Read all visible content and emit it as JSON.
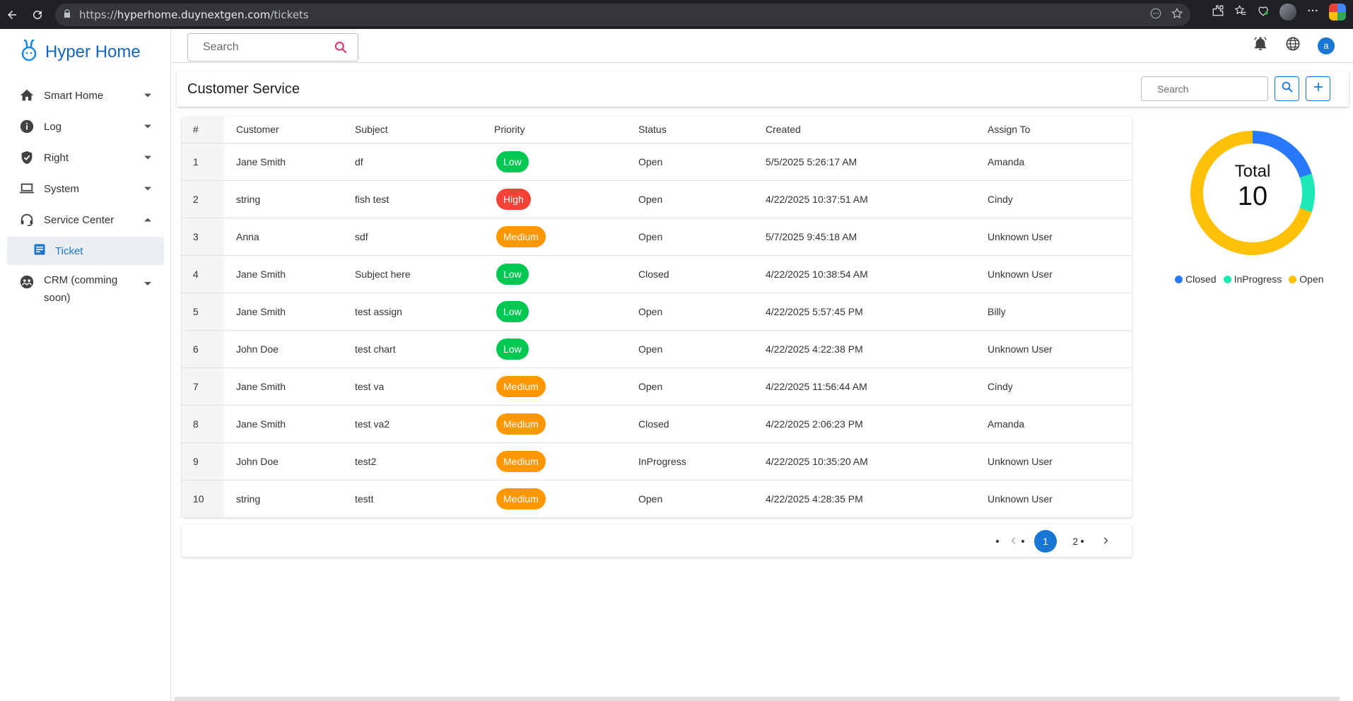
{
  "browser": {
    "url_scheme": "https://",
    "url_host": "hyperhome.duynextgen.com",
    "url_path": "/tickets"
  },
  "brand": {
    "name": "Hyper Home"
  },
  "sidebar": {
    "items": [
      {
        "label": "Smart Home",
        "icon": "home-icon",
        "expanded": false
      },
      {
        "label": "Log",
        "icon": "info-icon",
        "expanded": false
      },
      {
        "label": "Right",
        "icon": "shield-icon",
        "expanded": false
      },
      {
        "label": "System",
        "icon": "laptop-icon",
        "expanded": false
      },
      {
        "label": "Service Center",
        "icon": "headset-icon",
        "expanded": true,
        "children": [
          {
            "label": "Ticket",
            "icon": "ticket-icon",
            "active": true
          }
        ]
      },
      {
        "label": "CRM (comming soon)",
        "icon": "crm-icon",
        "expanded": false
      }
    ]
  },
  "topbar": {
    "search_placeholder": "Search",
    "user_initial": "a"
  },
  "header": {
    "title": "Customer Service",
    "search_placeholder": "Search"
  },
  "table": {
    "columns": [
      "#",
      "Customer",
      "Subject",
      "Priority",
      "Status",
      "Created",
      "Assign To"
    ],
    "rows": [
      {
        "num": "1",
        "customer": "Jane Smith",
        "subject": "df",
        "priority": "Low",
        "status": "Open",
        "created": "5/5/2025 5:26:17 AM",
        "assign": "Amanda"
      },
      {
        "num": "2",
        "customer": "string",
        "subject": "fish test",
        "priority": "High",
        "status": "Open",
        "created": "4/22/2025 10:37:51 AM",
        "assign": "Cindy"
      },
      {
        "num": "3",
        "customer": "Anna",
        "subject": "sdf",
        "priority": "Medium",
        "status": "Open",
        "created": "5/7/2025 9:45:18 AM",
        "assign": "Unknown User"
      },
      {
        "num": "4",
        "customer": "Jane Smith",
        "subject": "Subject here",
        "priority": "Low",
        "status": "Closed",
        "created": "4/22/2025 10:38:54 AM",
        "assign": "Unknown User"
      },
      {
        "num": "5",
        "customer": "Jane Smith",
        "subject": "test assign",
        "priority": "Low",
        "status": "Open",
        "created": "4/22/2025 5:57:45 PM",
        "assign": "Billy"
      },
      {
        "num": "6",
        "customer": "John Doe",
        "subject": "test chart",
        "priority": "Low",
        "status": "Open",
        "created": "4/22/2025 4:22:38 PM",
        "assign": "Unknown User"
      },
      {
        "num": "7",
        "customer": "Jane Smith",
        "subject": "test va",
        "priority": "Medium",
        "status": "Open",
        "created": "4/22/2025 11:56:44 AM",
        "assign": "Cindy"
      },
      {
        "num": "8",
        "customer": "Jane Smith",
        "subject": "test va2",
        "priority": "Medium",
        "status": "Closed",
        "created": "4/22/2025 2:06:23 PM",
        "assign": "Amanda"
      },
      {
        "num": "9",
        "customer": "John Doe",
        "subject": "test2",
        "priority": "Medium",
        "status": "InProgress",
        "created": "4/22/2025 10:35:20 AM",
        "assign": "Unknown User"
      },
      {
        "num": "10",
        "customer": "string",
        "subject": "testt",
        "priority": "Medium",
        "status": "Open",
        "created": "4/22/2025 4:28:35 PM",
        "assign": "Unknown User"
      }
    ]
  },
  "priority_colors": {
    "Low": "#00c853",
    "High": "#f44336",
    "Medium": "#ff9800"
  },
  "pagination": {
    "current": "1",
    "next": "2"
  },
  "donut": {
    "total_label": "Total",
    "total_value": "10",
    "segments": [
      {
        "name": "Closed",
        "value": 2,
        "color": "#2979ff"
      },
      {
        "name": "InProgress",
        "value": 1,
        "color": "#1de9b6"
      },
      {
        "name": "Open",
        "value": 7,
        "color": "#ffc107"
      }
    ]
  }
}
